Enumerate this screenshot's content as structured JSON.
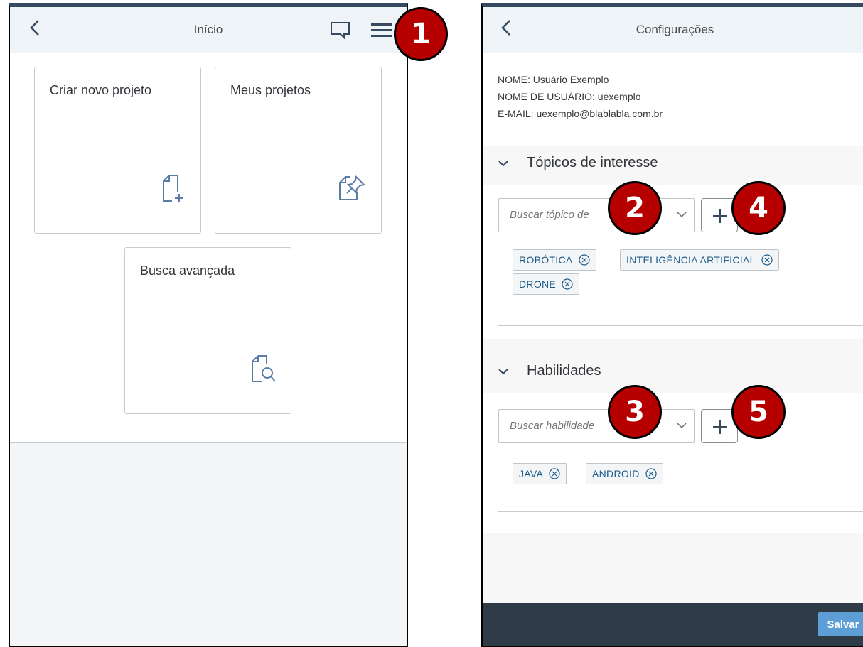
{
  "home": {
    "title": "Início",
    "tiles": [
      {
        "label": "Criar novo projeto",
        "icon": "new-document-icon"
      },
      {
        "label": "Meus projetos",
        "icon": "document-pin-icon"
      },
      {
        "label": "Busca avançada",
        "icon": "document-search-icon"
      }
    ]
  },
  "settings": {
    "title": "Configurações",
    "user": {
      "name": "NOME: Usuário Exemplo",
      "username": "NOME DE USUÁRIO: uexemplo",
      "email": "E-MAIL: uexemplo@blablabla.com.br"
    },
    "topics": {
      "title": "Tópicos de interesse",
      "placeholder": "Buscar tópico de",
      "tokens": [
        "ROBÓTICA",
        "INTELIGÊNCIA ARTIFICIAL",
        "DRONE"
      ]
    },
    "skills": {
      "title": "Habilidades",
      "placeholder": "Buscar habilidade",
      "tokens": [
        "JAVA",
        "ANDROID"
      ]
    },
    "save_label": "Salvar"
  },
  "callouts": [
    "1",
    "2",
    "3",
    "4",
    "5"
  ],
  "colors": {
    "shell": "#eff4f9",
    "accent": "#354a5f",
    "token_text": "#1a5c8c",
    "badge": "#b60000",
    "footer": "#2f3b46",
    "save": "#5e9ed6"
  }
}
